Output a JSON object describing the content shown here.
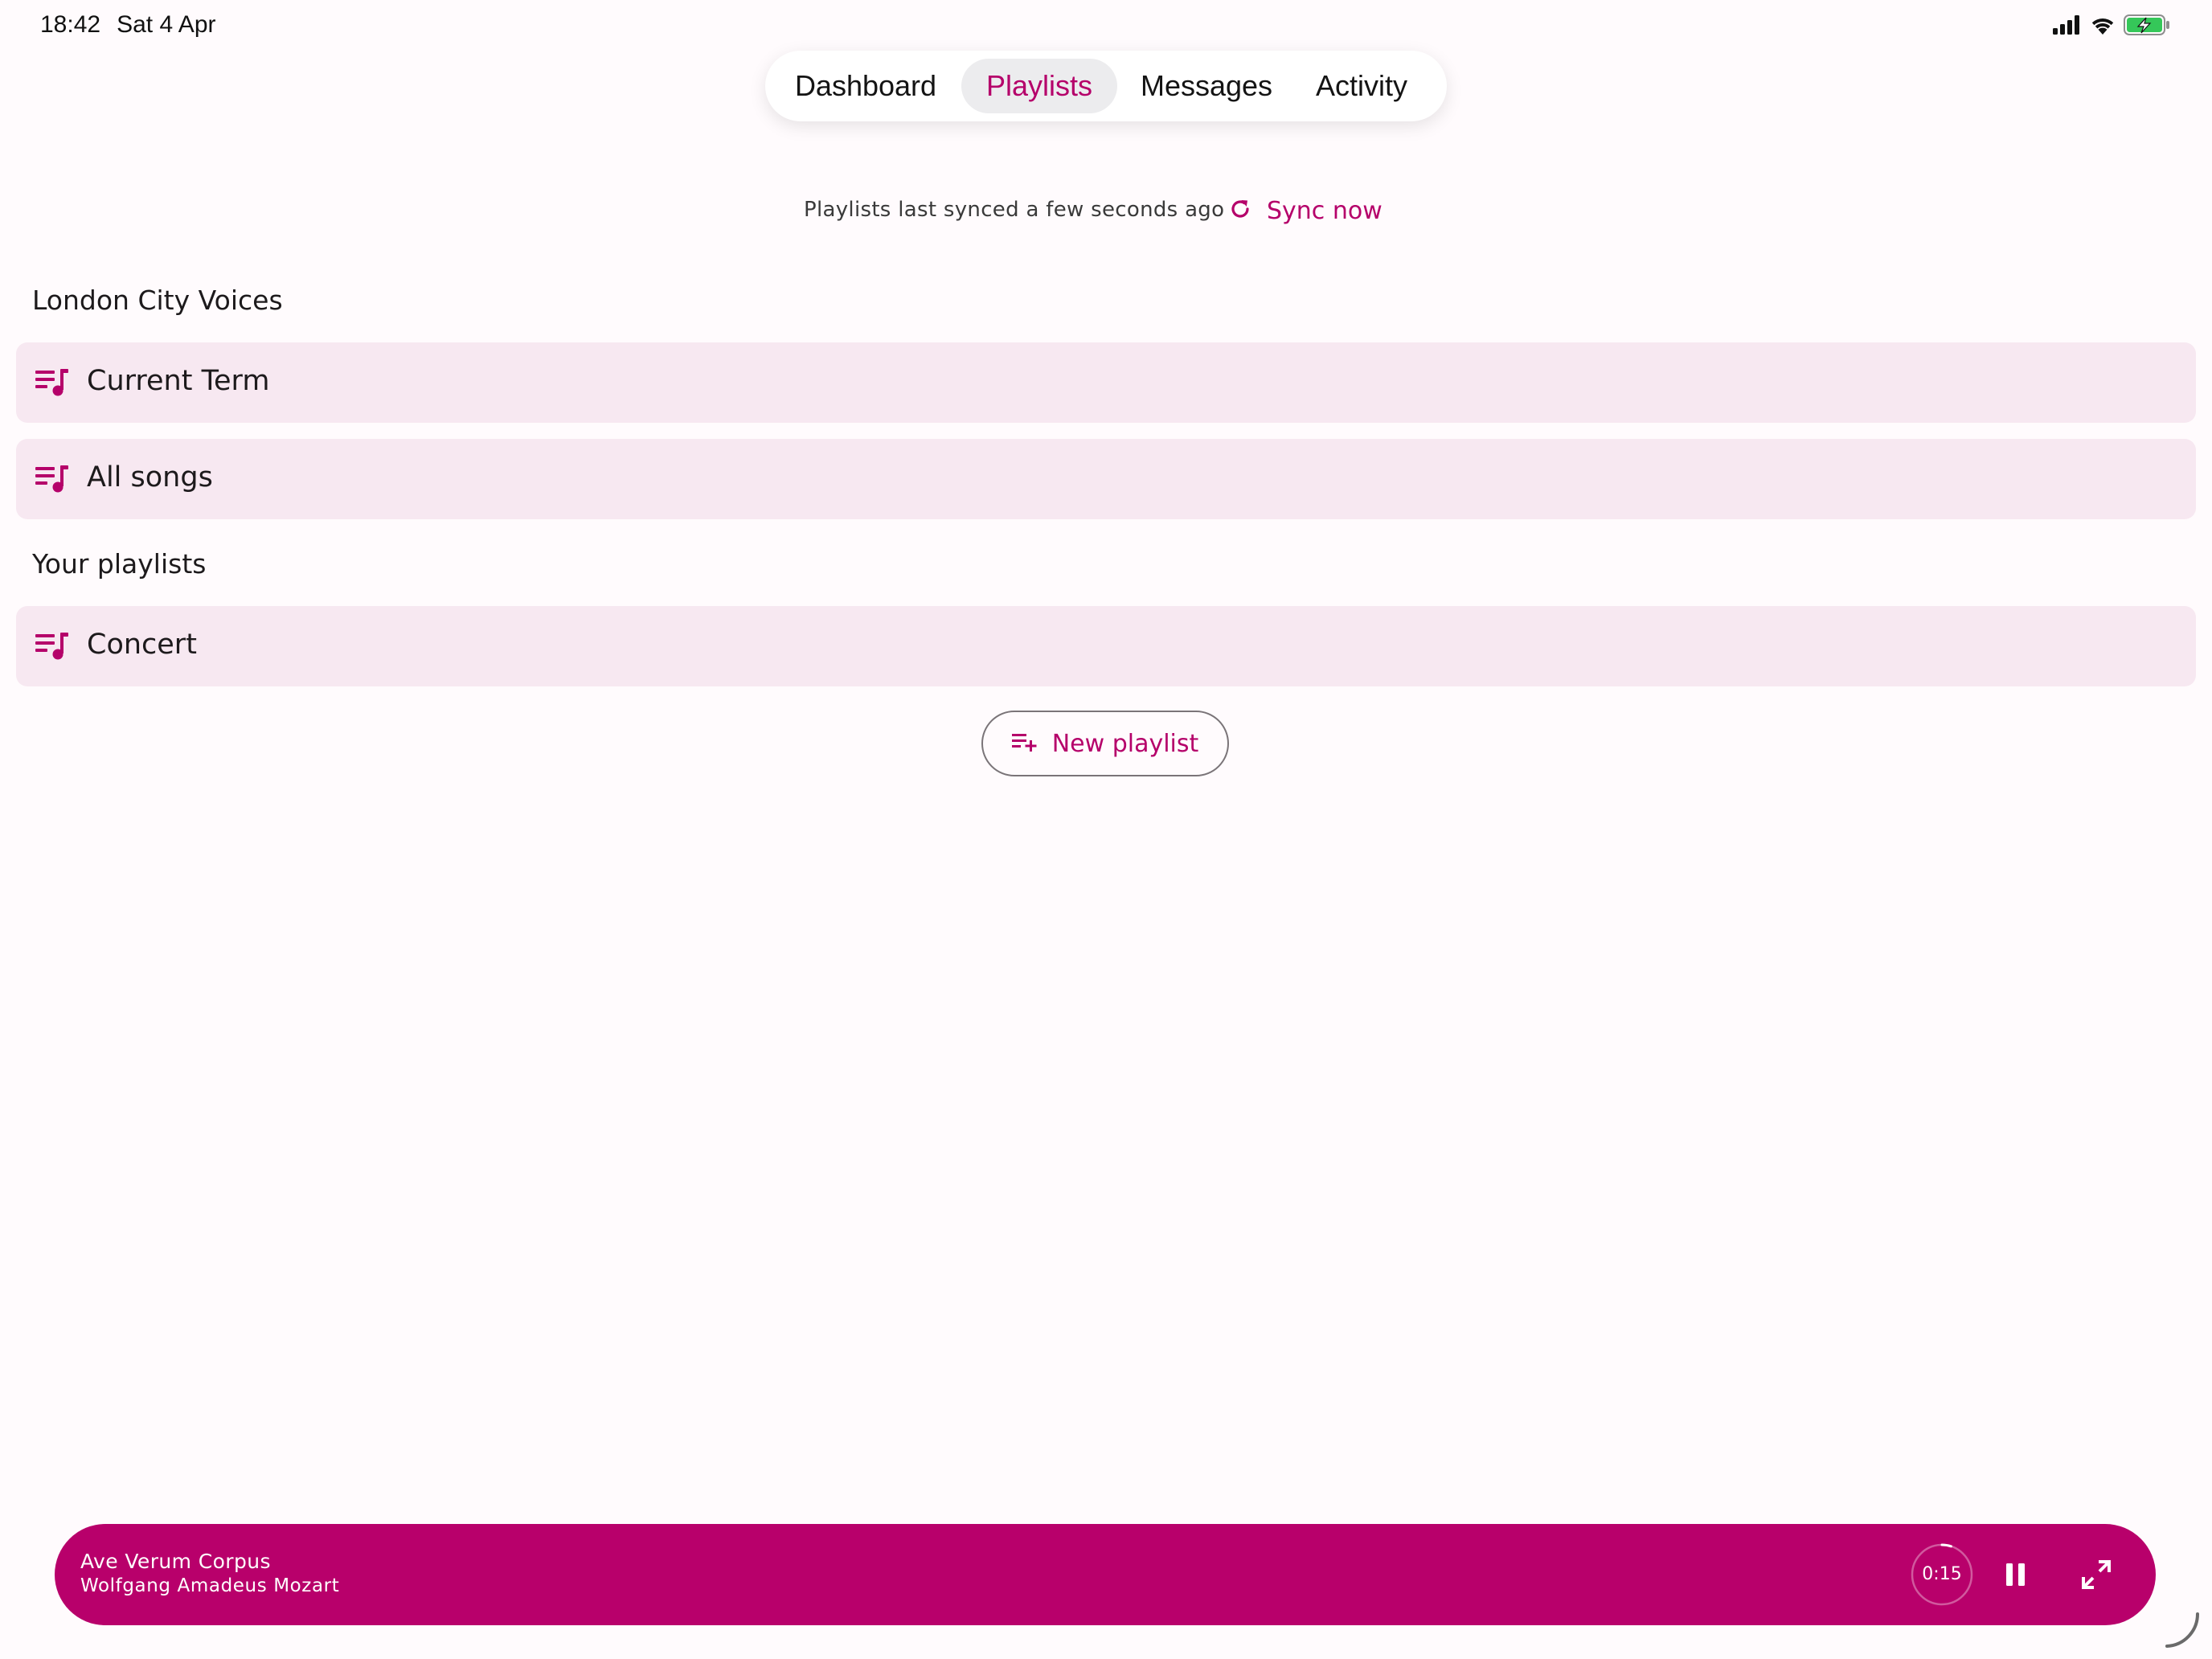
{
  "status_bar": {
    "time": "18:42",
    "date": "Sat 4 Apr",
    "icons": [
      "cellular-signal-icon",
      "wifi-icon",
      "battery-charging-icon"
    ]
  },
  "tabs": [
    {
      "label": "Dashboard",
      "active": false
    },
    {
      "label": "Playlists",
      "active": true
    },
    {
      "label": "Messages",
      "active": false
    },
    {
      "label": "Activity",
      "active": false
    }
  ],
  "sync": {
    "status_text": "Playlists last synced a few seconds ago",
    "button_label": "Sync now",
    "icon": "refresh-icon"
  },
  "sections": [
    {
      "title": "London City Voices",
      "playlists": [
        {
          "name": "Current Term",
          "icon": "playlist-music-icon"
        },
        {
          "name": "All songs",
          "icon": "playlist-music-icon"
        }
      ]
    },
    {
      "title": "Your playlists",
      "playlists": [
        {
          "name": "Concert",
          "icon": "playlist-music-icon"
        }
      ]
    }
  ],
  "new_playlist": {
    "label": "New playlist",
    "icon": "playlist-add-icon"
  },
  "player": {
    "title": "Ave Verum Corpus",
    "artist": "Wolfgang Amadeus Mozart",
    "elapsed": "0:15",
    "progress_fraction": 0.05,
    "icons": [
      "pause-icon",
      "expand-icon"
    ]
  },
  "colors": {
    "accent": "#b5006a",
    "player_background": "#b8006b",
    "row_background": "#f7e8f1",
    "page_background": "#fffbfd"
  }
}
